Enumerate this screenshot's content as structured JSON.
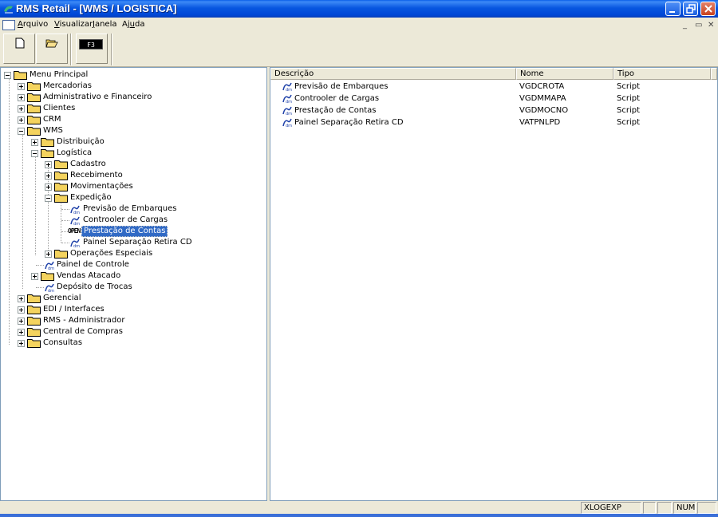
{
  "window": {
    "title": "RMS Retail - [WMS / LOGISTICA]"
  },
  "menubar": {
    "items": [
      {
        "underline": "A",
        "rest": "rquivo"
      },
      {
        "underline": "V",
        "rest": "isualizar"
      },
      {
        "underline": "J",
        "rest": "anela"
      },
      {
        "pre": "Aj",
        "underline": "u",
        "rest": "da"
      }
    ]
  },
  "toolbar": {
    "f3_label": "F3"
  },
  "tree": {
    "root": "Menu Principal",
    "mercadorias": "Mercadorias",
    "adm_fin": "Administrativo e Financeiro",
    "clientes": "Clientes",
    "crm": "CRM",
    "wms": "WMS",
    "distribuicao": "Distribuição",
    "logistica": "Logística",
    "cadastro": "Cadastro",
    "recebimento": "Recebimento",
    "movimentacoes": "Movimentações",
    "expedicao": "Expedição",
    "previsao": "Previsão de Embarques",
    "controoler": "Controoler de Cargas",
    "open_badge": "OPEN",
    "prestacao": "Prestação de Contas",
    "painel_sep": "Painel Separação Retira CD",
    "operacoes": "Operações Especiais",
    "painel_ctrl": "Painel de Controle",
    "vendas": "Vendas Atacado",
    "deposito": "Depósito de Trocas",
    "gerencial": "Gerencial",
    "edi": "EDI / Interfaces",
    "rms_adm": "RMS - Administrador",
    "central": "Central de Compras",
    "consultas": "Consultas"
  },
  "list": {
    "columns": [
      "Descrição",
      "Nome",
      "Tipo"
    ],
    "rows": [
      {
        "descricao": "Previsão de Embarques",
        "nome": "VGDCROTA",
        "tipo": "Script"
      },
      {
        "descricao": "Controoler de Cargas",
        "nome": "VGDMMAPA",
        "tipo": "Script"
      },
      {
        "descricao": "Prestação de Contas",
        "nome": "VGDMOCNO",
        "tipo": "Script"
      },
      {
        "descricao": "Painel Separação Retira CD",
        "nome": "VATPNLPD",
        "tipo": "Script"
      }
    ]
  },
  "status": {
    "program": "XLOGEXP",
    "num": "NUM"
  },
  "colors": {
    "title_bar": "#0047d6",
    "selection": "#316ac5",
    "folder": "#f4d35e"
  }
}
